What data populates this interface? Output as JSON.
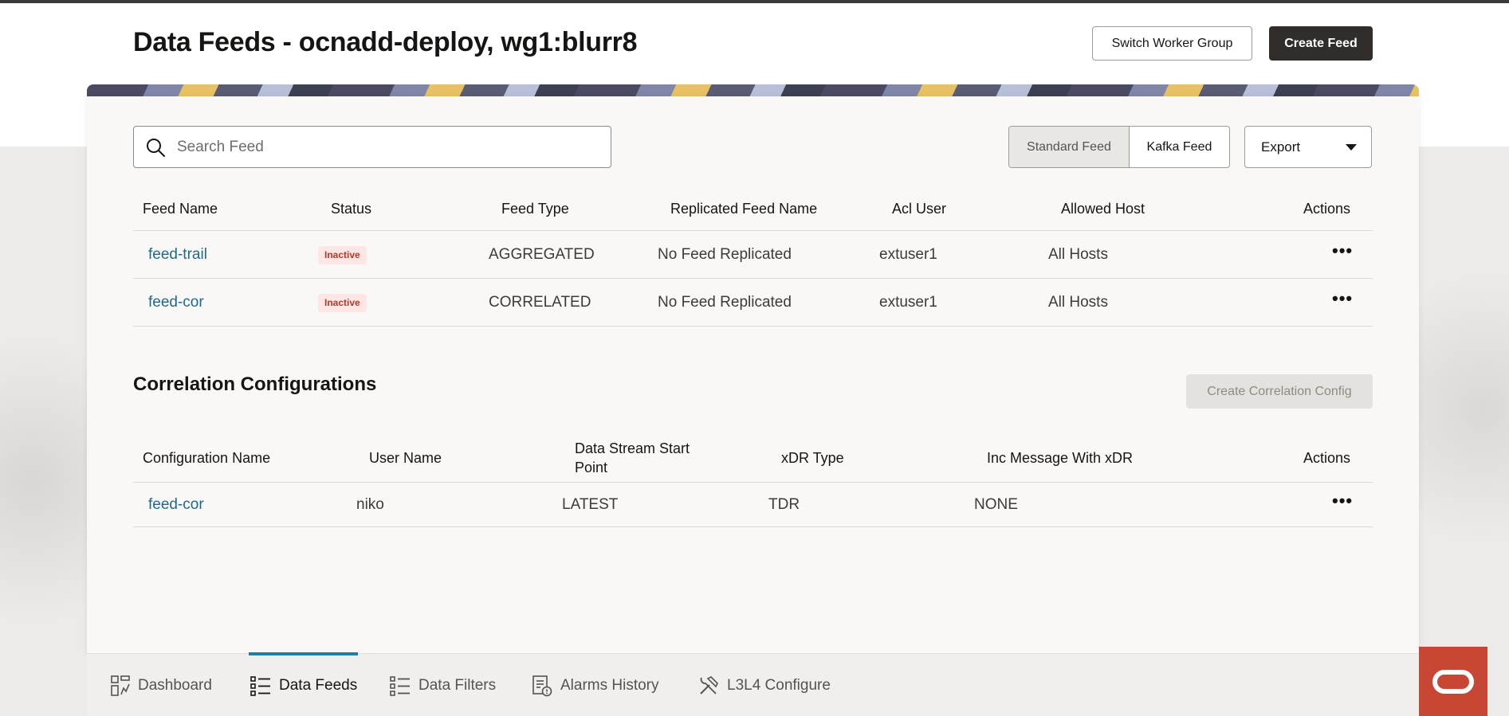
{
  "header": {
    "title": "Data Feeds - ocnadd-deploy, wg1:blurr8",
    "switch_worker_group": "Switch Worker Group",
    "create_feed": "Create Feed"
  },
  "toolbar": {
    "search_placeholder": "Search Feed",
    "feed_types": [
      "Standard Feed",
      "Kafka Feed"
    ],
    "selected_feed_type": "Standard Feed",
    "export_label": "Export"
  },
  "feeds_table": {
    "columns": [
      "Feed Name",
      "Status",
      "Feed Type",
      "Replicated Feed Name",
      "Acl User",
      "Allowed Host",
      "Actions"
    ],
    "rows": [
      {
        "name": "feed-trail",
        "status": "Inactive",
        "type": "AGGREGATED",
        "replicated": "No Feed Replicated",
        "acl_user": "extuser1",
        "allowed_host": "All Hosts",
        "actions": "•••"
      },
      {
        "name": "feed-cor",
        "status": "Inactive",
        "type": "CORRELATED",
        "replicated": "No Feed Replicated",
        "acl_user": "extuser1",
        "allowed_host": "All Hosts",
        "actions": "•••"
      }
    ]
  },
  "correlation": {
    "title": "Correlation Configurations",
    "create_button": "Create Correlation Config",
    "columns": [
      "Configuration Name",
      "User Name",
      "Data Stream Start Point",
      "xDR Type",
      "Inc Message With xDR",
      "Actions"
    ],
    "rows": [
      {
        "name": "feed-cor",
        "user": "niko",
        "start_point": "LATEST",
        "xdr_type": "TDR",
        "inc_message": "NONE",
        "actions": "•••"
      }
    ]
  },
  "nav": {
    "items": [
      {
        "label": "Dashboard",
        "icon": "dashboard-icon"
      },
      {
        "label": "Data Feeds",
        "icon": "list-icon"
      },
      {
        "label": "Data Filters",
        "icon": "list-icon"
      },
      {
        "label": "Alarms History",
        "icon": "alarm-history-icon"
      },
      {
        "label": "L3L4 Configure",
        "icon": "tools-icon"
      }
    ],
    "active": "Data Feeds"
  },
  "colors": {
    "accent": "#227e9e",
    "link": "#1f6a8c",
    "primary_button": "#312d2a",
    "oracle_red": "#c74634",
    "inactive_badge_bg": "#fde6e3",
    "inactive_badge_text": "#b13a2a"
  }
}
